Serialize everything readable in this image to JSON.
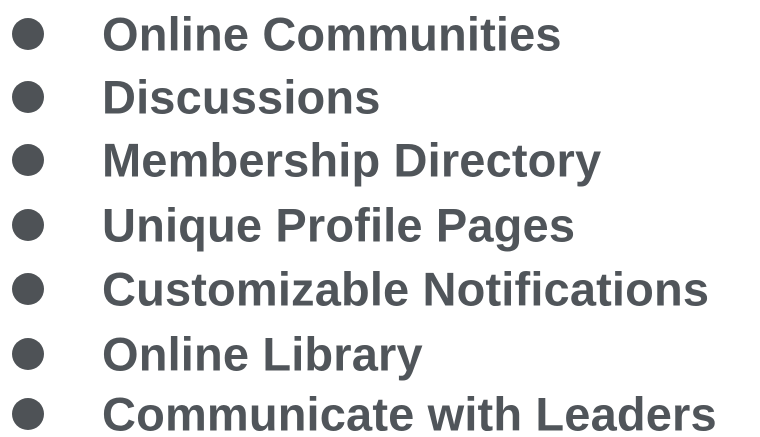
{
  "features": [
    {
      "label": "Online Communities",
      "icon": "bullet-dot-icon"
    },
    {
      "label": "Discussions",
      "icon": "bullet-dot-icon"
    },
    {
      "label": "Membership Directory",
      "icon": "bullet-dot-icon"
    },
    {
      "label": "Unique Profile Pages",
      "icon": "bullet-dot-icon"
    },
    {
      "label": "Customizable Notifications",
      "icon": "bullet-dot-icon"
    },
    {
      "label": "Online Library",
      "icon": "bullet-dot-icon"
    },
    {
      "label": "Communicate with Leaders",
      "icon": "bullet-dot-icon"
    }
  ],
  "colors": {
    "text": "#50555a",
    "bullet": "#4e5256",
    "background": "#ffffff"
  }
}
